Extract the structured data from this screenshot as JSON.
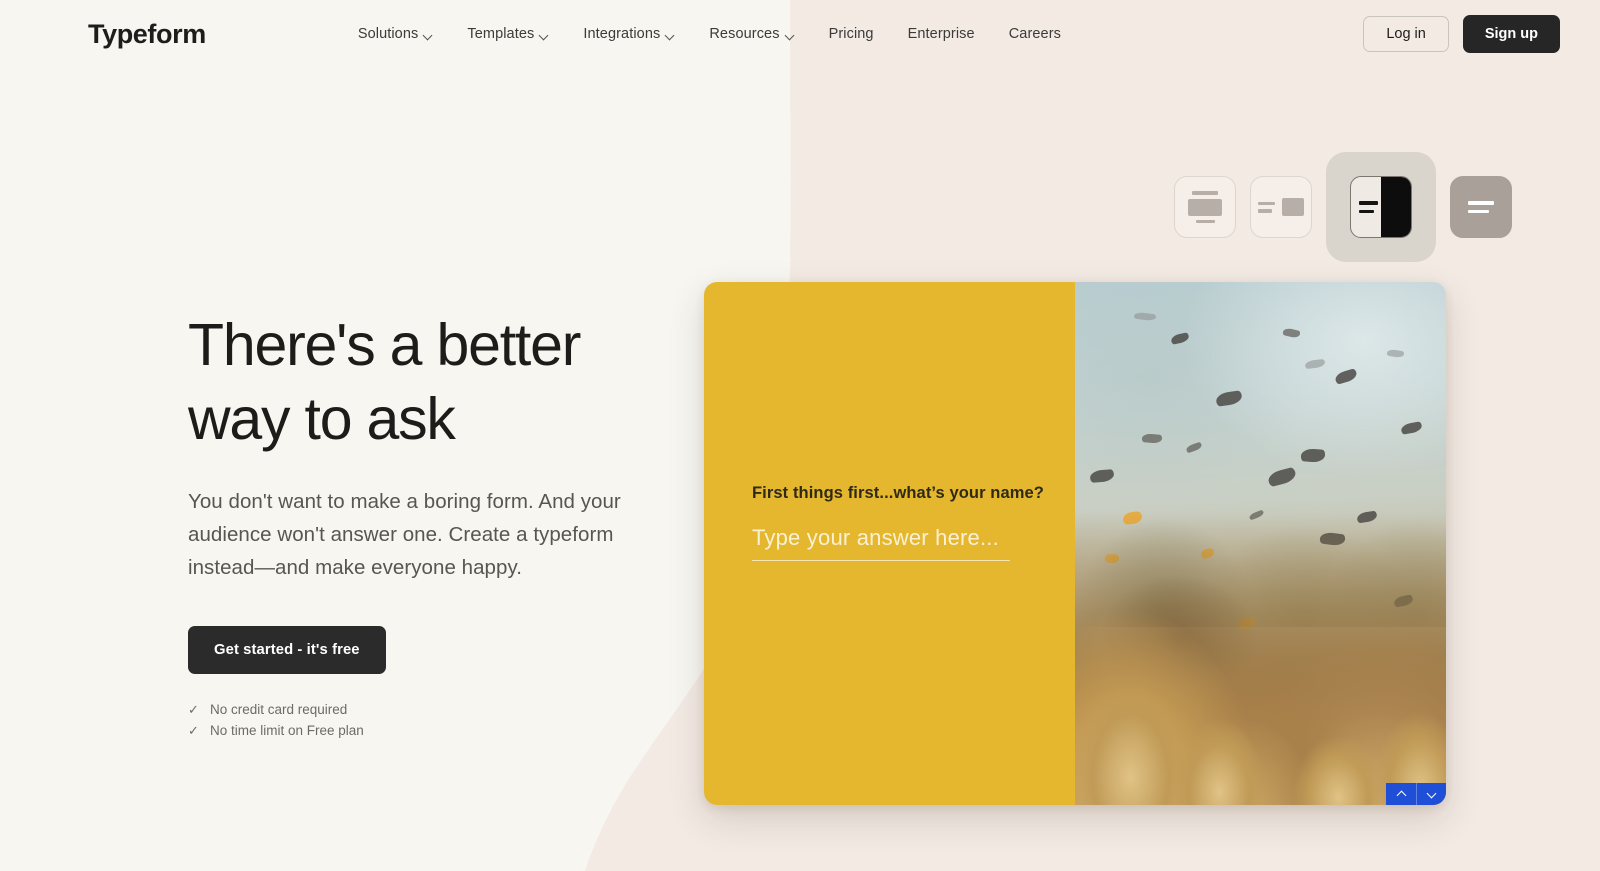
{
  "header": {
    "logo": "Typeform",
    "nav": [
      {
        "label": "Solutions",
        "has_dropdown": true,
        "icon": "chevron-down-icon"
      },
      {
        "label": "Templates",
        "has_dropdown": true,
        "icon": "chevron-down-icon"
      },
      {
        "label": "Integrations",
        "has_dropdown": true,
        "icon": "chevron-down-icon"
      },
      {
        "label": "Resources",
        "has_dropdown": true,
        "icon": "chevron-down-icon"
      },
      {
        "label": "Pricing",
        "has_dropdown": false,
        "icon": ""
      },
      {
        "label": "Enterprise",
        "has_dropdown": false,
        "icon": ""
      },
      {
        "label": "Careers",
        "has_dropdown": false,
        "icon": ""
      }
    ],
    "login_label": "Log in",
    "signup_label": "Sign up"
  },
  "layout_switcher": {
    "options": [
      {
        "name": "layout-stacked",
        "icon": "layout-stacked-icon",
        "selected": false,
        "style": "outline"
      },
      {
        "name": "layout-side-image",
        "icon": "layout-side-image-icon",
        "selected": false,
        "style": "outline"
      },
      {
        "name": "layout-split",
        "icon": "layout-split-icon",
        "selected": true,
        "style": "split"
      },
      {
        "name": "layout-full-cover",
        "icon": "layout-full-cover-icon",
        "selected": false,
        "style": "solid"
      }
    ]
  },
  "hero": {
    "title": "There's a better way to ask",
    "subtitle": "You don't want to make a boring form. And your audience won't answer one. Create a typeform instead—and make everyone happy.",
    "cta_label": "Get started - it's free",
    "benefits": [
      {
        "check": "✓",
        "label": "No credit card required"
      },
      {
        "check": "✓",
        "label": "No time limit on Free plan"
      }
    ]
  },
  "form_preview": {
    "question": "First things first...what’s your name?",
    "answer_value": "",
    "answer_placeholder": "Type your answer here...",
    "panel_color": "#e4b72f",
    "media_alt": "underwater coral reef with fish",
    "nav_up_icon": "chevron-up-icon",
    "nav_down_icon": "chevron-down-icon",
    "nav_color": "#1e4fd6"
  },
  "theme": {
    "page_background": "#f7f6f1",
    "accent_background": "#f3eae4",
    "text_primary": "#1c1c1a",
    "text_muted": "#58564f",
    "button_dark": "#2b2b2b"
  }
}
